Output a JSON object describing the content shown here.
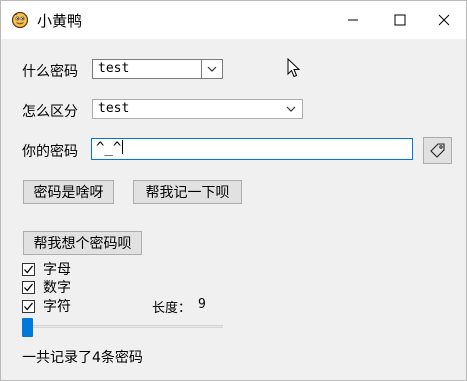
{
  "window": {
    "title": "小黄鸭",
    "controls": {
      "minimize": "minimize",
      "maximize": "maximize",
      "close": "close"
    }
  },
  "form": {
    "password_type_label": "什么密码",
    "password_type_value": "test",
    "distinguish_label": "怎么区分",
    "distinguish_value": "test",
    "your_password_label": "你的密码",
    "your_password_value": "^_^"
  },
  "buttons": {
    "what_password": "密码是啥呀",
    "remember": "帮我记一下呗",
    "generate": "帮我想个密码呗"
  },
  "options": {
    "letters": {
      "label": "字母",
      "checked": true
    },
    "digits": {
      "label": "数字",
      "checked": true
    },
    "symbols": {
      "label": "字符",
      "checked": true
    }
  },
  "length": {
    "label": "长度：",
    "value": "9",
    "slider_fraction": 0.0
  },
  "status": {
    "summary": "一共记录了4条密码"
  },
  "icons": [
    "duck-app-icon",
    "minimize-icon",
    "maximize-icon",
    "close-icon",
    "tag-icon",
    "chevron-down-icon",
    "check-icon",
    "mouse-cursor-icon"
  ],
  "colors": {
    "accent": "#0078d7",
    "window_bg": "#f0f0f0",
    "button_bg": "#e1e1e1"
  }
}
